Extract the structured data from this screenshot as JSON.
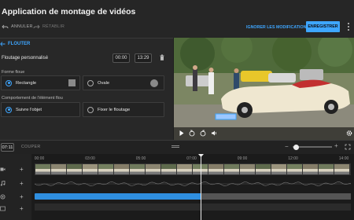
{
  "header": {
    "title": "Application de montage de vidéos",
    "undo_label": "ANNULER",
    "redo_label": "RÉTABLIR",
    "discard_label": "IGNORER LES MODIFICATIONS",
    "save_label": "ENREGISTRER"
  },
  "panel": {
    "back_label": "FLOUTER",
    "custom_blur_label": "Floutage personnalisé",
    "start_time": "00:00",
    "end_time": "13:29",
    "shape_label": "Forme floue",
    "shape_options": [
      "Rectangle",
      "Ovale"
    ],
    "selected_shape": "Rectangle",
    "behavior_label": "Comportement de l'élément flou",
    "behavior_options": [
      "Suivre l'objet",
      "Fixer le floutage"
    ],
    "selected_behavior": "Suivre l'objet"
  },
  "timeline": {
    "current_time": "07:11",
    "cut_label": "COUPER",
    "ruler_labels": [
      "00:00",
      "03:00",
      "05:00",
      "07:00",
      "09:00",
      "12:00",
      "14:00"
    ],
    "playhead_fraction": 0.52,
    "blur_segment_fraction": 0.52
  },
  "colors": {
    "accent": "#3ea6ff",
    "background": "#1f1f1f",
    "panel": "#282828"
  }
}
